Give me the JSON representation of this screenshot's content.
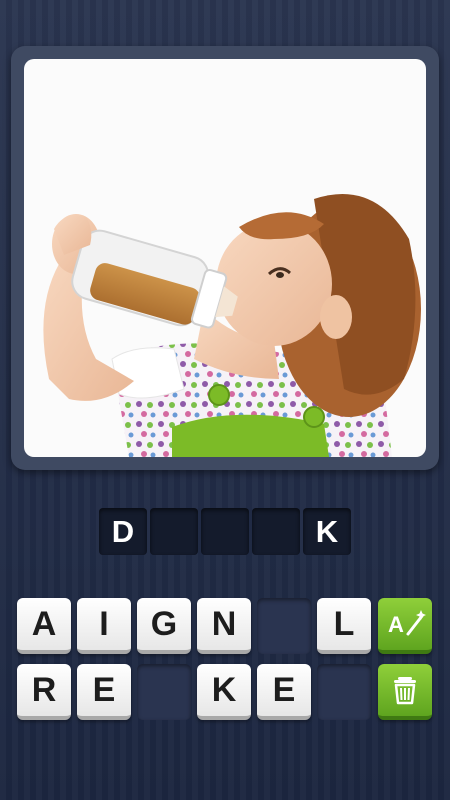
{
  "puzzle": {
    "image": "baby drinking juice from a baby bottle",
    "answer_slots": [
      "D",
      "",
      "",
      "",
      "K"
    ]
  },
  "letter_rows": [
    [
      "A",
      "I",
      "G",
      "N",
      "",
      "L"
    ],
    [
      "R",
      "E",
      "",
      "K",
      "E",
      ""
    ]
  ],
  "actions": {
    "reveal_icon": "letter-wand-icon",
    "remove_icon": "trash-icon",
    "color": "#6cb52a"
  },
  "colors": {
    "background": "#222c45",
    "frame": "#3f4a62",
    "slot": "#141b2c",
    "accent_green": "#6cb52a"
  }
}
